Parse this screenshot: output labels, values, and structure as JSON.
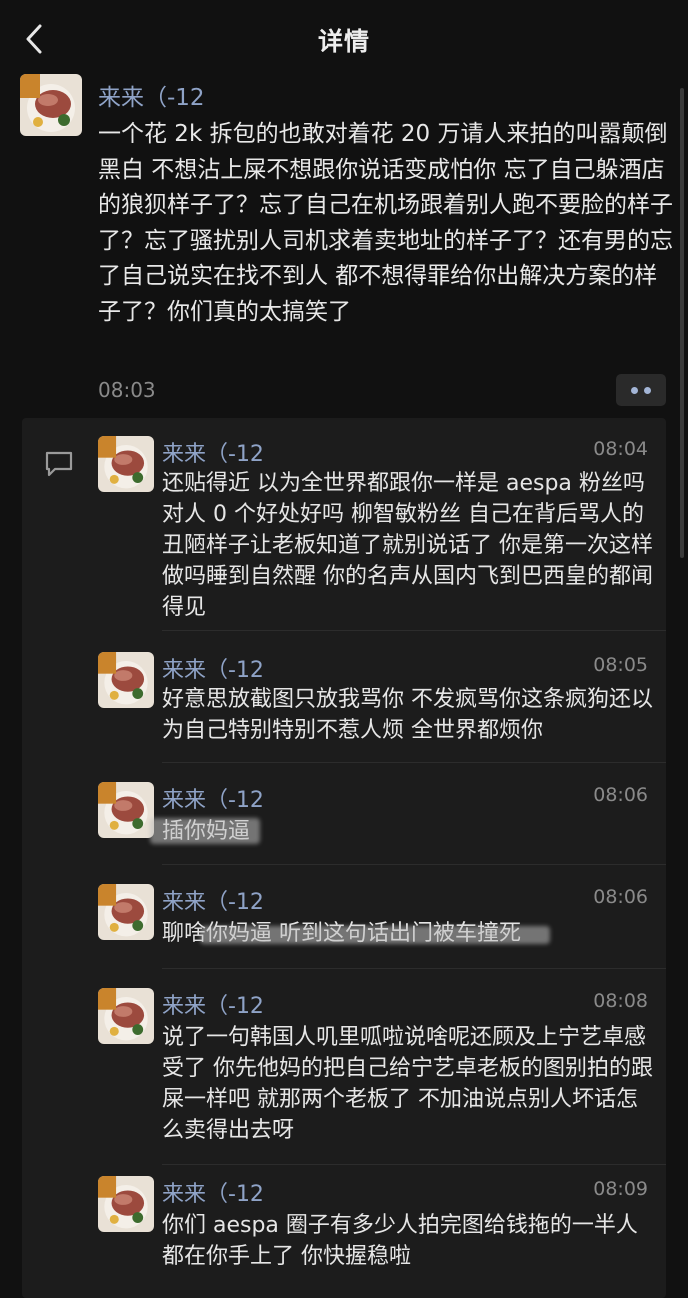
{
  "header": {
    "title": "详情",
    "back_icon": "chevron-left-icon"
  },
  "post": {
    "name": "来来（-12",
    "text": "一个花 2k 拆包的也敢对着花 20 万请人来拍的叫嚣颠倒黑白 不想沾上屎不想跟你说话变成怕你 忘了自己躲酒店的狼狈样子了？忘了自己在机场跟着别人跑不要脸的样子了？忘了骚扰别人司机求着卖地址的样子了？还有男的忘了自己说实在找不到人 都不想得罪给你出解决方案的样子了？你们真的太搞笑了",
    "time": "08:03"
  },
  "comments": [
    {
      "name": "来来（-12",
      "time": "08:04",
      "text": "还贴得近 以为全世界都跟你一样是 aespa 粉丝吗 对人 0 个好处好吗 柳智敏粉丝 自己在背后骂人的丑陋样子让老板知道了就别说话了 你是第一次这样做吗睡到自然醒 你的名声从国内飞到巴西皇的都闻得见"
    },
    {
      "name": "来来（-12",
      "time": "08:05",
      "text": "好意思放截图只放我骂你 不发疯骂你这条疯狗还以为自己特别特别不惹人烦 全世界都烦你"
    },
    {
      "name": "来来（-12",
      "time": "08:06",
      "text": "插你妈逼"
    },
    {
      "name": "来来（-12",
      "time": "08:06",
      "text": "聊啥你妈逼 听到这句话出门被车撞死"
    },
    {
      "name": "来来（-12",
      "time": "08:08",
      "text": "说了一句韩国人叽里呱啦说啥呢还顾及上宁艺卓感受了 你先他妈的把自己给宁艺卓老板的图别拍的跟屎一样吧 就那两个老板了 不加油说点别人坏话怎么卖得出去呀"
    },
    {
      "name": "来来（-12",
      "time": "08:09",
      "text": "你们 aespa 圈子有多少人拍完图给钱拖的一半人都在你手上了 你快握稳啦"
    }
  ],
  "colors": {
    "background": "#111111",
    "panel": "#1c1c1c",
    "name": "#8fa3c7",
    "text": "#e6e6e6",
    "time": "#8a8a8a"
  }
}
